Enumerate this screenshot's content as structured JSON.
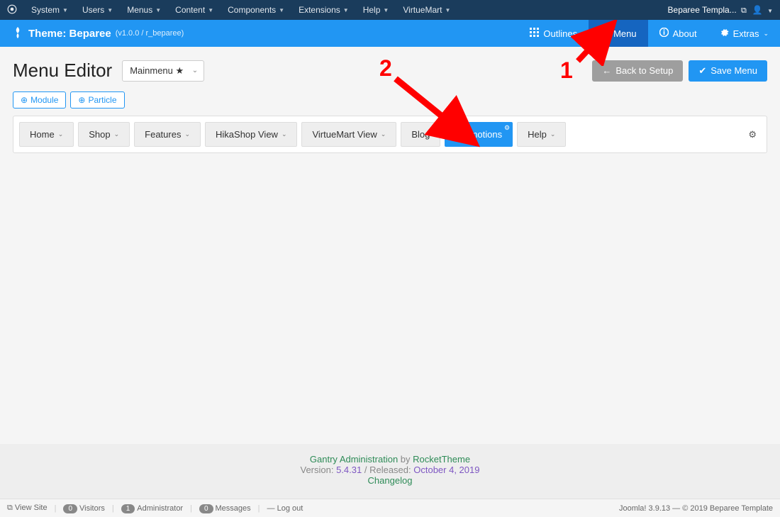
{
  "adminbar": {
    "menus": [
      "System",
      "Users",
      "Menus",
      "Content",
      "Components",
      "Extensions",
      "Help",
      "VirtueMart"
    ],
    "right_label": "Beparee Templa..."
  },
  "gantrybar": {
    "theme_prefix": "Theme:",
    "theme_name": "Beparee",
    "theme_version": "(v1.0.0 / r_beparee)",
    "nav": {
      "outlines": "Outlines",
      "menu": "Menu",
      "about": "About",
      "extras": "Extras"
    }
  },
  "editor": {
    "title": "Menu Editor",
    "select_value": "Mainmenu ★",
    "back_btn": "Back to Setup",
    "save_btn": "Save Menu",
    "module_btn": "Module",
    "particle_btn": "Particle",
    "items": [
      {
        "label": "Home",
        "dropdown": true
      },
      {
        "label": "Shop",
        "dropdown": true
      },
      {
        "label": "Features",
        "dropdown": true
      },
      {
        "label": "HikaShop View",
        "dropdown": true
      },
      {
        "label": "VirtueMart View",
        "dropdown": true
      },
      {
        "label": "Blog",
        "dropdown": false
      },
      {
        "label": "Promotions",
        "dropdown": false,
        "active": true
      },
      {
        "label": "Help",
        "dropdown": true
      }
    ]
  },
  "annotations": {
    "num1": "1",
    "num2": "2"
  },
  "credits": {
    "link1": "Gantry Administration",
    "by": " by ",
    "link2": "RocketTheme",
    "version_label": "Version: ",
    "version": "5.4.31",
    "released_label": " / Released: ",
    "released": "October 4, 2019",
    "changelog": "Changelog"
  },
  "statusbar": {
    "view_site": "View Site",
    "visitors_count": "0",
    "visitors": "Visitors",
    "admin_count": "1",
    "admin": "Administrator",
    "msg_count": "0",
    "messages": "Messages",
    "logout": "Log out",
    "right": "Joomla! 3.9.13  —  © 2019 Beparee Template"
  }
}
